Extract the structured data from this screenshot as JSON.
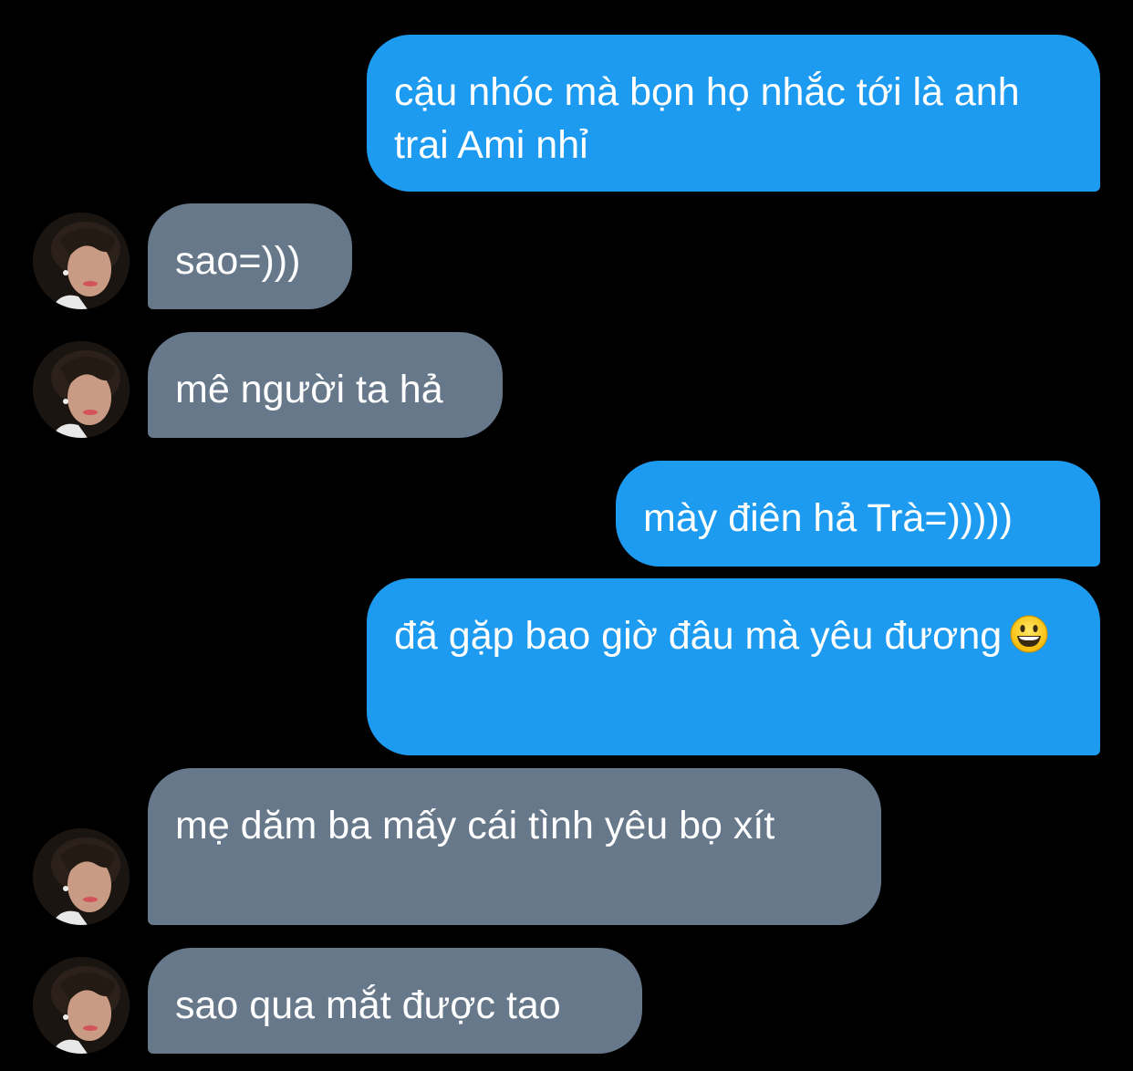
{
  "messages": [
    {
      "side": "outgoing",
      "text": "cậu nhóc mà bọn họ nhắc tới là anh trai Ami nhỉ"
    },
    {
      "side": "incoming",
      "text": "sao=)))"
    },
    {
      "side": "incoming",
      "text": "mê người ta hả"
    },
    {
      "side": "outgoing",
      "text": "mày điên hả Trà=)))))"
    },
    {
      "side": "outgoing",
      "text": "đã gặp bao giờ đâu mà yêu đương",
      "emoji": "grinning-face-emoji"
    },
    {
      "side": "incoming",
      "text": "mẹ dăm ba mấy cái tình yêu bọ xít"
    },
    {
      "side": "incoming",
      "text": "sao qua mắt được tao"
    }
  ],
  "colors": {
    "background": "#000000",
    "outgoing_bubble": "#1d9bf0",
    "incoming_bubble": "#66788a",
    "text": "#ffffff"
  },
  "avatar_icon": "profile-photo-avatar"
}
